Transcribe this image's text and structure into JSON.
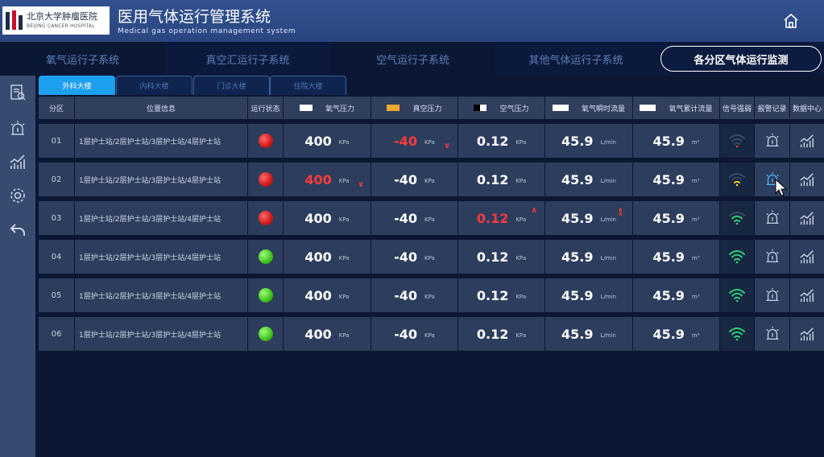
{
  "header": {
    "logo_cn": "北京大学肿瘤医院",
    "logo_en": "BEIJING CANCER HOSPITAL",
    "title_cn": "医用气体运行管理系统",
    "title_en": "Medical gas operation management system"
  },
  "nav": {
    "tabs": [
      {
        "label": "氧气运行子系统"
      },
      {
        "label": "真空汇运行子系统"
      },
      {
        "label": "空气运行子系统"
      },
      {
        "label": "其他气体运行子系统"
      },
      {
        "label": "各分区气体运行监测"
      }
    ],
    "active_index": 4
  },
  "subtabs": [
    {
      "label": "外科大楼"
    },
    {
      "label": "内科大楼"
    },
    {
      "label": "门诊大楼"
    },
    {
      "label": "住院大楼"
    }
  ],
  "table": {
    "headers": {
      "zone": "分区",
      "location": "位置信息",
      "status": "运行状态",
      "oxygen": "氧气压力",
      "vacuum": "真空压力",
      "air": "空气压力",
      "flow": "氧气瞬时流量",
      "total": "氧气累计流量",
      "signal": "信号强弱",
      "alarm": "报警记录",
      "data": "数据中心"
    },
    "swatch_colors": {
      "oxygen": "#ffffff",
      "vacuum": "#f0a830",
      "air": "#ffffff",
      "flow": "#ffffff",
      "total": "#ffffff"
    },
    "units": {
      "pressure": "KPa",
      "flow": "L/min",
      "total": "m³"
    },
    "rows": [
      {
        "zone": "01",
        "location": "1层护士站/2层护士站/3层护士站/4层护士站",
        "status": "red",
        "oxygen": "400",
        "vacuum": "-40",
        "air": "0.12",
        "flow": "45.9",
        "total": "45.9",
        "signal": "weak",
        "alarm_active": false
      },
      {
        "zone": "02",
        "location": "1层护士站/2层护士站/3层护士站/4层护士站",
        "status": "red",
        "oxygen": "400",
        "vacuum": "-40",
        "air": "0.12",
        "flow": "45.9",
        "total": "45.9",
        "signal": "medium",
        "alarm_active": true
      },
      {
        "zone": "03",
        "location": "1层护士站/2层护士站/3层护士站/4层护士站",
        "status": "red",
        "oxygen": "400",
        "vacuum": "-40",
        "air": "0.12",
        "flow": "45.9",
        "total": "45.9",
        "signal": "good",
        "alarm_active": false
      },
      {
        "zone": "04",
        "location": "1层护士站/2层护士站/3层护士站/4层护士站",
        "status": "green",
        "oxygen": "400",
        "vacuum": "-40",
        "air": "0.12",
        "flow": "45.9",
        "total": "45.9",
        "signal": "full",
        "alarm_active": false
      },
      {
        "zone": "05",
        "location": "1层护士站/2层护士站/3层护士站/4层护士站",
        "status": "green",
        "oxygen": "400",
        "vacuum": "-40",
        "air": "0.12",
        "flow": "45.9",
        "total": "45.9",
        "signal": "full",
        "alarm_active": false
      },
      {
        "zone": "06",
        "location": "1层护士站/2层护士站/3层护士站/4层护士站",
        "status": "green",
        "oxygen": "400",
        "vacuum": "-40",
        "air": "0.12",
        "flow": "45.9",
        "total": "45.9",
        "signal": "full",
        "alarm_active": false
      }
    ]
  },
  "sidebar": {
    "icons": [
      "report-icon",
      "alarm-icon",
      "chart-icon",
      "settings-icon",
      "back-icon"
    ]
  },
  "colors": {
    "accent": "#1ea0f0",
    "alarm": "#ff3b3b",
    "ok": "#3dc21c"
  }
}
